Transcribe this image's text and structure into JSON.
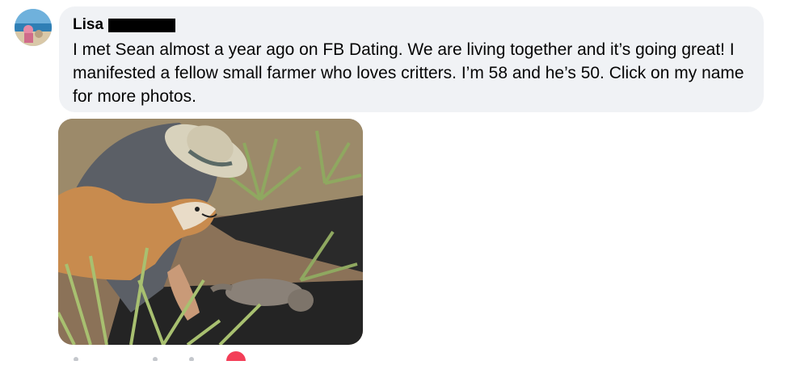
{
  "comment": {
    "author_name": "Lisa",
    "text": "I met Sean almost a year ago on FB Dating. We are living together and it’s going great! I manifested a fellow small farmer who loves critters. I’m 58 and he’s 50. Click on my name for more photos."
  },
  "icons": {
    "avatar": "profile-photo",
    "reaction": "heart-reaction-icon"
  },
  "colors": {
    "bubble_background": "#f0f2f5",
    "text": "#050505",
    "reaction": "#f33e58"
  }
}
